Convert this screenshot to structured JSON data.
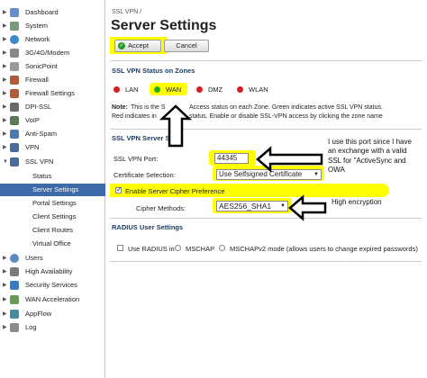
{
  "nav": {
    "dashboard": "Dashboard",
    "system": "System",
    "network": "Network",
    "modem": "3G/4G/Modem",
    "sonicpoint": "SonicPoint",
    "firewall": "Firewall",
    "firewall_settings": "Firewall Settings",
    "dpi_ssl": "DPI-SSL",
    "voip": "VoIP",
    "anti_spam": "Anti-Spam",
    "vpn": "VPN",
    "ssl_vpn": "SSL VPN",
    "status": "Status",
    "server_settings": "Server Settings",
    "portal_settings": "Portal Settings",
    "client_settings": "Client Settings",
    "client_routes": "Client Routes",
    "virtual_office": "Virtual Office",
    "users": "Users",
    "high_availability": "High Availability",
    "security_services": "Security Services",
    "wan_acceleration": "WAN Acceleration",
    "appflow": "AppFlow",
    "log": "Log"
  },
  "header": {
    "breadcrumb": "SSL VPN /",
    "title": "Server Settings",
    "accept": "Accept",
    "cancel": "Cancel"
  },
  "zones": {
    "heading": "SSL VPN Status on Zones",
    "lan": "LAN",
    "wan": "WAN",
    "dmz": "DMZ",
    "wlan": "WLAN",
    "note_label": "Note:",
    "note_line1": "This is the S",
    "note_line1b": "Access status on each Zone. Green indicates active SSL VPN status.",
    "note_line2a": "Red indicates in",
    "note_line2b": "status. Enable or disable SSL-VPN access by clicking the zone name"
  },
  "server": {
    "heading": "SSL VPN Server S",
    "port_label": "SSL VPN Port:",
    "port_value": "44345",
    "cert_label": "Certificate Selection:",
    "cert_value": "Use Selfsigned Certificate",
    "cipher_pref_label": "Enable Server Cipher Preference",
    "cipher_methods_label": "Cipher Methods:",
    "cipher_value": "AES256_SHA1"
  },
  "radius": {
    "heading": "RADIUS User Settings",
    "use_radius": "Use RADIUS in",
    "mschap": "MSCHAP",
    "mschapv2": "MSCHAPv2 mode (allows users to change expired passwords)"
  },
  "annotations": {
    "note_port": "I use this port since I have an exchange with a valid SSL for \"ActiveSync and OWA",
    "note_cipher": "High encryption"
  },
  "colors": {
    "highlight": "#ffff00",
    "zone_red": "#d42020",
    "zone_green": "#22b022",
    "nav_selected": "#3d6aa8"
  }
}
